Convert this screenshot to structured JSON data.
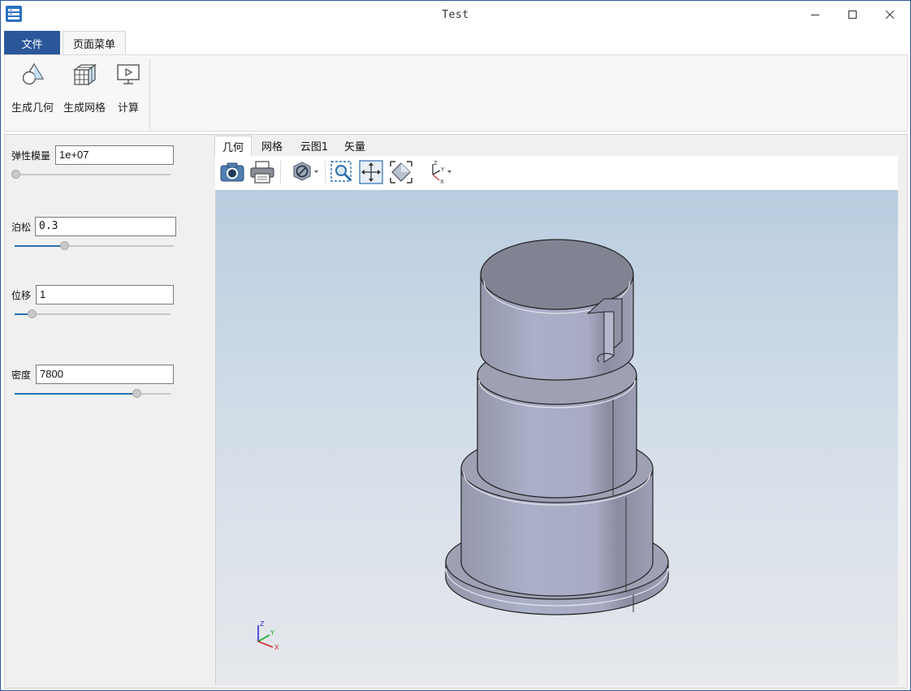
{
  "window": {
    "title": "Test",
    "controls": {
      "minimize": "minimize-icon",
      "maximize": "maximize-icon",
      "close": "close-icon"
    }
  },
  "ribbon": {
    "tabs": [
      {
        "label": "文件"
      },
      {
        "label": "页面菜单"
      }
    ],
    "buttons": [
      {
        "label": "生成几何",
        "icon": "geometry-shapes-icon"
      },
      {
        "label": "生成网格",
        "icon": "mesh-cube-icon"
      },
      {
        "label": "计算",
        "icon": "compute-monitor-icon"
      }
    ]
  },
  "parameters": [
    {
      "label": "弹性模量",
      "value": "1e+07",
      "slider_fraction": 0.0
    },
    {
      "label": "泊松",
      "value": "0.3",
      "slider_fraction": 0.3
    },
    {
      "label": "位移",
      "value": "1",
      "slider_fraction": 0.09
    },
    {
      "label": "密度",
      "value": "7800",
      "slider_fraction": 0.8
    }
  ],
  "view": {
    "tabs": [
      {
        "label": "几何"
      },
      {
        "label": "网格"
      },
      {
        "label": "云图1"
      },
      {
        "label": "矢量"
      }
    ],
    "active_tab": "几何",
    "toolbar": [
      "camera-icon",
      "print-icon",
      "hide-shape-icon",
      "zoom-window-icon",
      "pan-icon",
      "fit-all-icon",
      "axis-orientation-icon"
    ],
    "triad_labels": {
      "z": "Z",
      "y": "Y",
      "x": "X"
    }
  },
  "colors": {
    "accent": "#2b579a",
    "viewport_top": "#b9cde0",
    "viewport_bottom": "#e6e8ec",
    "model_body": "#9ea0b3"
  }
}
